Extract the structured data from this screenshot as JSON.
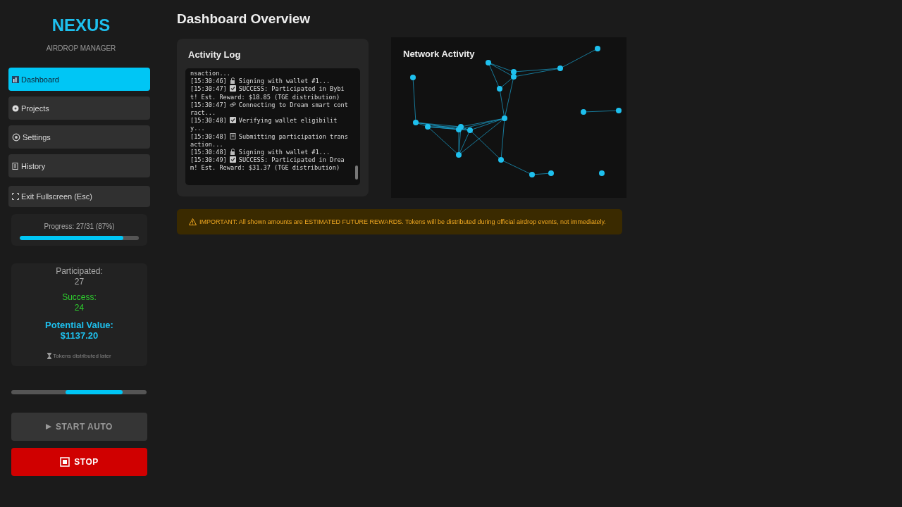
{
  "brand": {
    "title": "NEXUS",
    "subtitle": "AIRDROP MANAGER"
  },
  "nav": [
    {
      "label": "Dashboard",
      "kind": "chart",
      "selected": true
    },
    {
      "label": "Projects",
      "kind": "disc",
      "selected": false
    },
    {
      "label": "Settings",
      "kind": "gear",
      "selected": false
    },
    {
      "label": "History",
      "kind": "scroll",
      "selected": false
    },
    {
      "label": "Exit Fullscreen (Esc)",
      "kind": "expand",
      "selected": false
    }
  ],
  "progress": {
    "label": "Progress: 27/31 (87%)",
    "level": 0.87
  },
  "stats": {
    "participated_label": "Participated:",
    "participated": "27",
    "success_label": "Success:",
    "success": "24",
    "value_label": "Potential Value:",
    "value": "$1137.20",
    "note": "Tokens distributed later"
  },
  "buttons": [
    {
      "kind": "start",
      "label": "START AUTO",
      "disabled": true
    },
    {
      "kind": "stop",
      "label": "STOP",
      "disabled": false
    }
  ],
  "page_title": "Dashboard Overview",
  "activity_log": {
    "title": "Activity Log",
    "entries": [
      {
        "kind": "text",
        "text": "nsaction..."
      },
      {
        "time": "[15:30:46]",
        "kind": "pen",
        "text": "Signing with wallet #1..."
      },
      {
        "time": "[15:30:47]",
        "kind": "check",
        "text": "SUCCESS: Participated in Bybit! Est. Reward: $18.85 (TGE distribution)"
      },
      {
        "time": "[15:30:47]",
        "kind": "link",
        "text": "Connecting to Dream smart contract..."
      },
      {
        "time": "[15:30:48]",
        "kind": "check",
        "text": "Verifying wallet eligibility..."
      },
      {
        "time": "[15:30:48]",
        "kind": "doc",
        "text": "Submitting participation transaction..."
      },
      {
        "time": "[15:30:48]",
        "kind": "pen",
        "text": "Signing with wallet #1..."
      },
      {
        "time": "[15:30:49]",
        "kind": "check",
        "text": "SUCCESS: Participated in Dream! Est. Reward: $31.37 (TGE distribution)"
      }
    ]
  },
  "network": {
    "title": "Network Activity"
  },
  "notice": {
    "text": "IMPORTANT: All shown amounts are ESTIMATED FUTURE REWARDS. Tokens will be distributed during official airdrop events, not immediately."
  }
}
